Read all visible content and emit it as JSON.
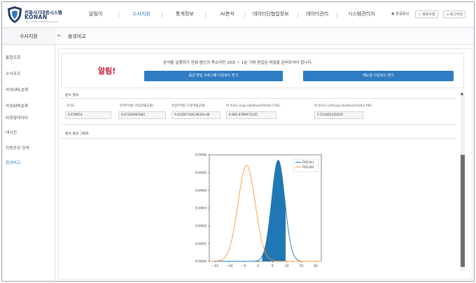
{
  "header": {
    "logo_line1": "전화사기대응시스템",
    "logo_line2": "KONAN",
    "logo_line3": "Voice phishing response system",
    "nav": [
      "알림이",
      "수사지원",
      "통계정보",
      "AI분석",
      "데이터단협업정보",
      "데이터관리",
      "시스템관리자"
    ],
    "active_nav": "수사지원",
    "user": "홍길동님",
    "info_button": "정보수정",
    "logout_button": "로그아웃"
  },
  "sidebar": {
    "title": "수사지원",
    "items": [
      "통합조회",
      "수사공조",
      "악성URL분류",
      "악성APK분류",
      "비정형데이터",
      "대시전",
      "자동완성 검색",
      "음성비교"
    ],
    "active": "음성비교"
  },
  "page": {
    "back_icon": "arrow-left-icon",
    "title": "음성비교"
  },
  "alert": {
    "label": "알림!",
    "message": "분석을 실행하기 전에 범인의 목소리만 20초 ~ 1분 가량 편집된 파일을 준비하셔야 합니다.",
    "button1": "음성 편집 프로그램 다운로드 받기",
    "button2": "매뉴얼 다운로드 받기"
  },
  "result": {
    "section_label": "분석 결과",
    "headers": [
      "유사도",
      "유일무이함 (유입측불균형)",
      "유일무이함 (기준측불균형)",
      "비 유사도 (Log Likelihood Ratio/ COS)",
      "비 유사도 LLR(Log Likelihood Ratio/ PIE)"
    ],
    "values": [
      "0.678954",
      "9.67193997082",
      "9.412957426.0932e-06",
      "6.983.9789471245",
      "5.523362220229"
    ]
  },
  "chart_section_label": "분석 결과 그래프",
  "chart_data": {
    "type": "area",
    "x_ticks": [
      "−15",
      "−10",
      "−5",
      "0",
      "5",
      "10",
      "15",
      "20"
    ],
    "y_ticks": [
      "0.0000",
      "0.0001",
      "0.0002",
      "0.0003",
      "0.0004",
      "0.0005",
      "0.0006"
    ],
    "xlim": [
      -17,
      22
    ],
    "ylim": [
      0,
      0.0006
    ],
    "series": [
      {
        "name": "P(E|Hs)",
        "mean": 7,
        "sd": 2.3,
        "peak": 0.00057,
        "color": "#1f77b4"
      },
      {
        "name": "P(E|Hd)",
        "mean": -4,
        "sd": 3.0,
        "peak": 0.00054,
        "color": "#ff9933"
      }
    ],
    "shaded_range": [
      1.4,
      9.5
    ],
    "marker_x": 9.5,
    "legend_position": "upper-right"
  }
}
